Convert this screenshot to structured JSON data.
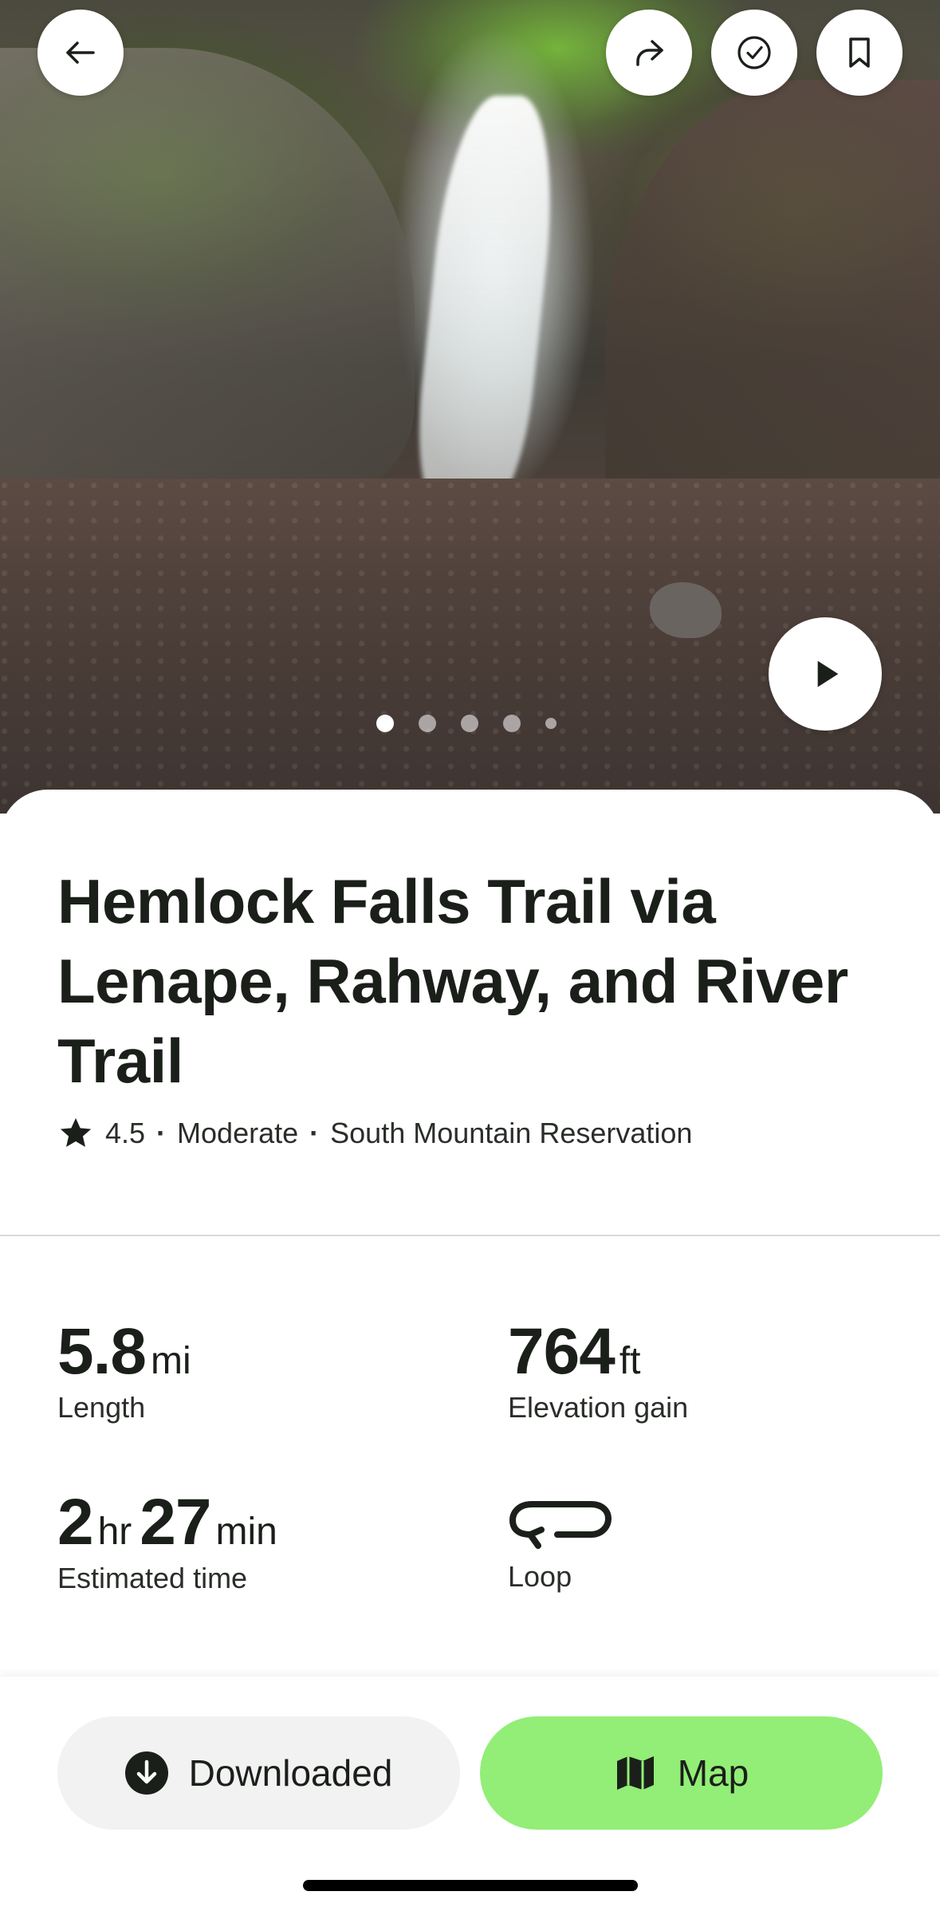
{
  "hero": {
    "photo_count": 5,
    "active_photo_index": 0,
    "icons": {
      "back": "arrow-left-icon",
      "share": "share-icon",
      "complete": "check-circle-icon",
      "save": "bookmark-icon",
      "play": "play-icon"
    }
  },
  "trail": {
    "title": "Hemlock Falls Trail via Lenape, Rahway, and River Trail",
    "rating": "4.5",
    "difficulty": "Moderate",
    "park": "South Mountain Reservation",
    "separator": "·"
  },
  "stats": {
    "length": {
      "value": "5.8",
      "unit": "mi",
      "label": "Length"
    },
    "elevation": {
      "value": "764",
      "unit": "ft",
      "label": "Elevation gain"
    },
    "time": {
      "hours": "2",
      "hours_unit": "hr",
      "minutes": "27",
      "minutes_unit": "min",
      "label": "Estimated time"
    },
    "route_type": {
      "icon": "loop-icon",
      "label": "Loop"
    }
  },
  "actions": {
    "download_label": "Downloaded",
    "download_icon": "download-circle-icon",
    "map_label": "Map",
    "map_icon": "map-icon"
  },
  "colors": {
    "map_button": "#92ee76",
    "download_button": "#f2f2f2",
    "text": "#1b1f1a"
  }
}
